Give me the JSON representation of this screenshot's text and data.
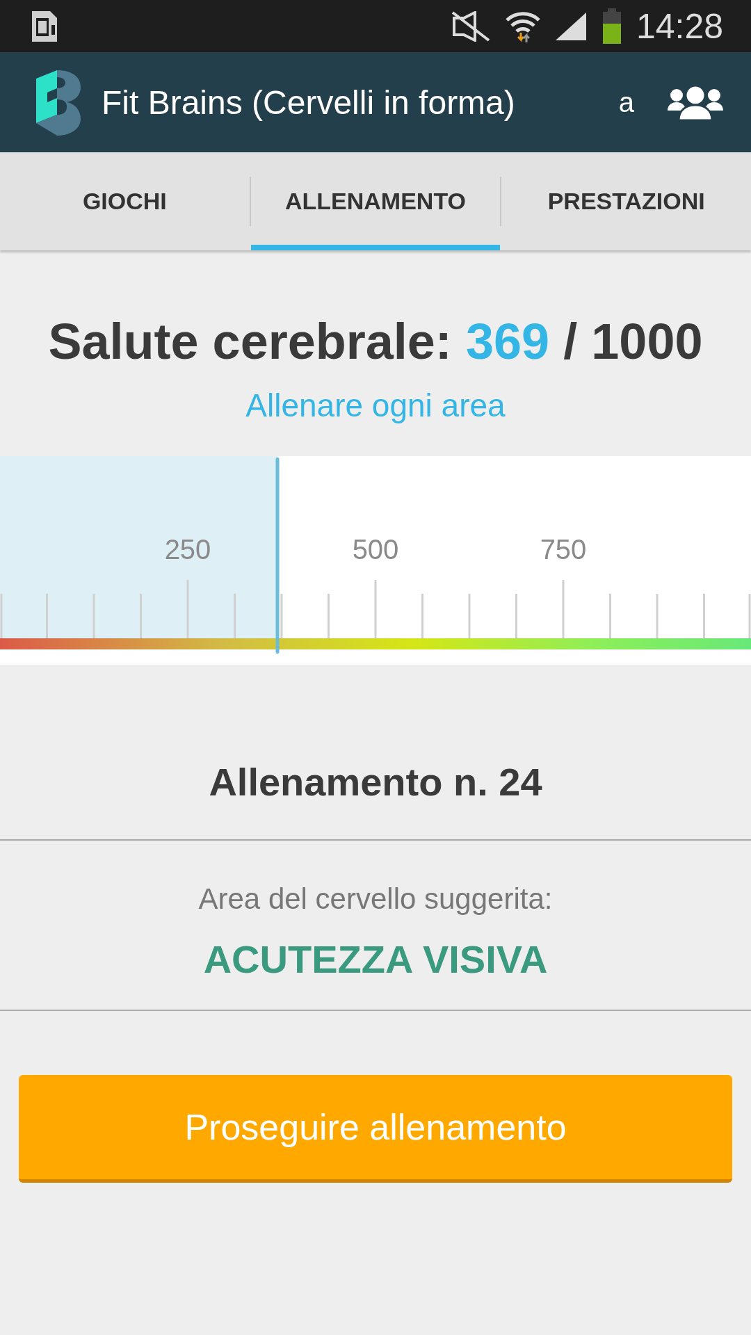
{
  "status_bar": {
    "time": "14:28"
  },
  "app_bar": {
    "title": "Fit Brains (Cervelli in forma)",
    "account": "a"
  },
  "tabs": [
    {
      "label": "GIOCHI",
      "selected": false
    },
    {
      "label": "ALLENAMENTO",
      "selected": true
    },
    {
      "label": "PRESTAZIONI",
      "selected": false
    }
  ],
  "brain_health": {
    "label": "Salute cerebrale:",
    "score": "369",
    "total": "/ 1000",
    "link": "Allenare ogni area"
  },
  "gauge": {
    "level": 0.369,
    "tick_labels": [
      "250",
      "500",
      "750"
    ]
  },
  "workout": {
    "title": "Allenamento n. 24",
    "suggestion_label": "Area del cervello suggerita:",
    "suggested_area": "ACUTEZZA VISIVA"
  },
  "button": {
    "label": "Proseguire allenamento"
  }
}
